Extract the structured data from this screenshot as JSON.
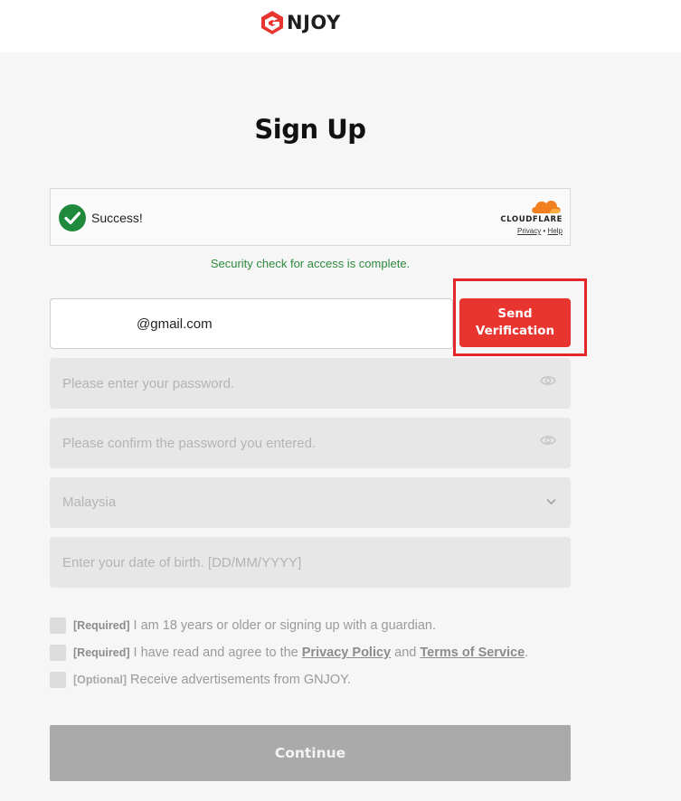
{
  "brand": {
    "logo_text": "NJOY",
    "accent_color": "#e8352f"
  },
  "page": {
    "title": "Sign Up"
  },
  "captcha": {
    "status": "Success!",
    "provider": "CLOUDFLARE",
    "privacy_link": "Privacy",
    "separator": "•",
    "help_link": "Help",
    "message": "Security check for access is complete."
  },
  "form": {
    "email_value": "@gmail.com",
    "send_button": "Send Verification",
    "password_placeholder": "Please enter your password.",
    "confirm_placeholder": "Please confirm the password you entered.",
    "country_value": "Malaysia",
    "dob_placeholder": "Enter your date of birth. [DD/MM/YYYY]"
  },
  "agreements": [
    {
      "tag": "[Required]",
      "text": "I am 18 years or older or signing up with a guardian."
    },
    {
      "tag": "[Required]",
      "text_before": "I have read and agree to the",
      "privacy": "Privacy Policy",
      "and": "and",
      "terms": "Terms of Service",
      "end": "."
    },
    {
      "tag": "[Optional]",
      "text": "Receive advertisements from GNJOY."
    }
  ],
  "continue_label": "Continue",
  "icons": {
    "check": "check-circle-icon",
    "eye": "eye-icon",
    "chevron": "chevron-down-icon",
    "cloud": "cloudflare-cloud-icon"
  }
}
